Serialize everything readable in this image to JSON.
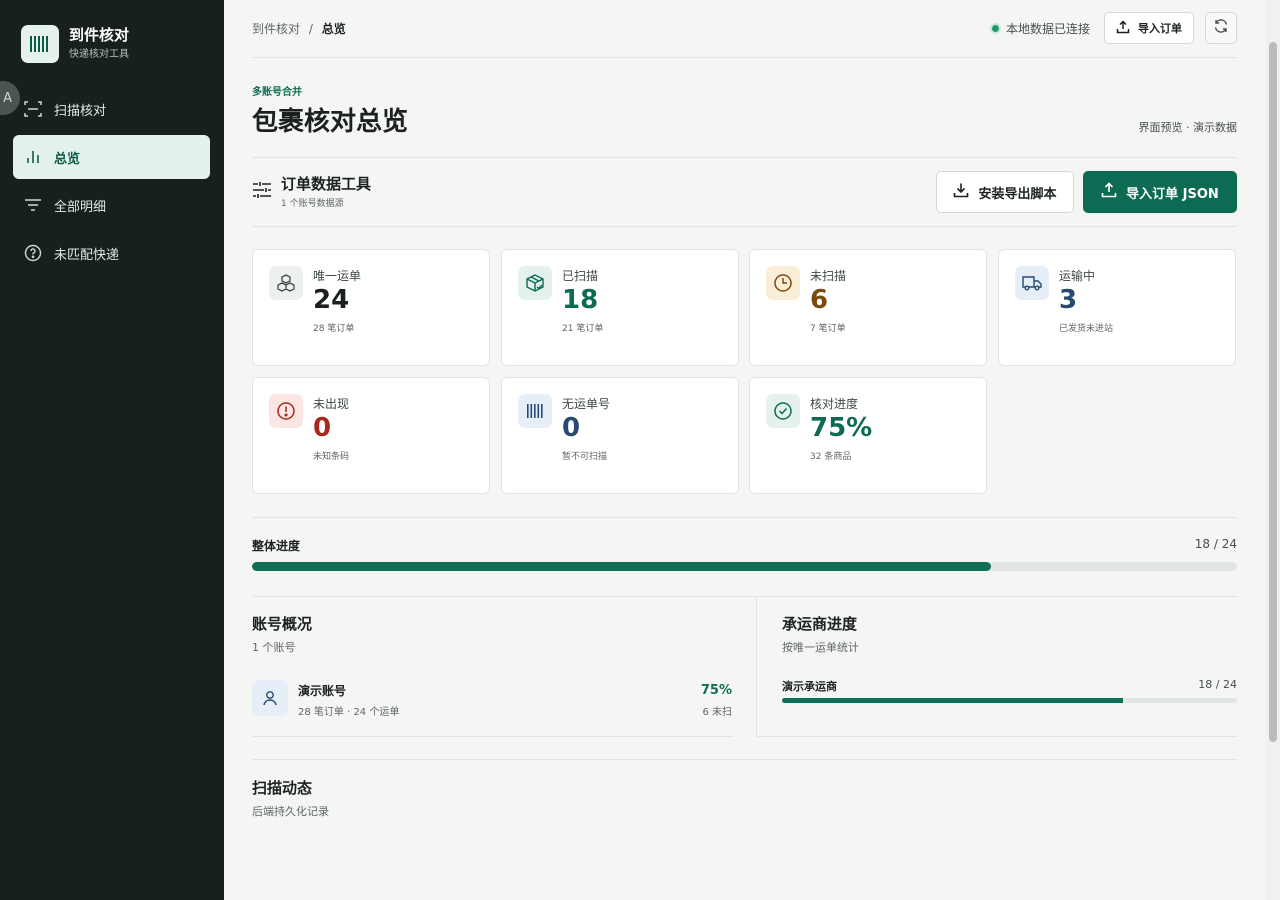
{
  "sidebar": {
    "brand_title": "到件核对",
    "brand_sub": "快递核对工具",
    "lang_badge": "A",
    "items": [
      {
        "label": "扫描核对",
        "icon": "scan-icon"
      },
      {
        "label": "总览",
        "icon": "bar-chart-icon",
        "active": true
      },
      {
        "label": "全部明细",
        "icon": "filter-list-icon"
      },
      {
        "label": "未匹配快递",
        "icon": "question-circle-icon"
      }
    ]
  },
  "topbar": {
    "crumb_parent": "到件核对",
    "crumb_sep": "/",
    "crumb_current": "总览",
    "status": "本地数据已连接",
    "import_label": "导入订单"
  },
  "header": {
    "eyebrow": "多账号合并",
    "title": "包裹核对总览",
    "preview_note": "界面预览 · 演示数据"
  },
  "tools": {
    "title": "订单数据工具",
    "sub": "1 个账号数据源",
    "install_label": "安装导出脚本",
    "json_label": "导入订单 JSON"
  },
  "cards": [
    {
      "label": "唯一运单",
      "value": "24",
      "sub": "28 笔订单",
      "icon": "packages-icon",
      "color": "#1a211e",
      "bg": "#eef0ef"
    },
    {
      "label": "已扫描",
      "value": "18",
      "sub": "21 笔订单",
      "icon": "box-check-icon",
      "color": "#0d6b54",
      "bg": "#e4f1ec"
    },
    {
      "label": "未扫描",
      "value": "6",
      "sub": "7 笔订单",
      "icon": "clock-icon",
      "color": "#7a4a0e",
      "bg": "#fbeed8"
    },
    {
      "label": "运输中",
      "value": "3",
      "sub": "已发货未进站",
      "icon": "truck-icon",
      "color": "#264a72",
      "bg": "#e6eef7"
    },
    {
      "label": "未出现",
      "value": "0",
      "sub": "未知条码",
      "icon": "alert-circle-icon",
      "color": "#a8281e",
      "bg": "#fbe6e3"
    },
    {
      "label": "无运单号",
      "value": "0",
      "sub": "暂不可扫描",
      "icon": "barcode-icon",
      "color": "#264a72",
      "bg": "#e6eef7"
    },
    {
      "label": "核对进度",
      "value": "75%",
      "sub": "32 条商品",
      "icon": "check-circle-icon",
      "color": "#0d6b54",
      "bg": "#e4f1ec"
    }
  ],
  "progress": {
    "label": "整体进度",
    "count": "18 / 24",
    "fraction": 0.75
  },
  "accounts": {
    "title": "账号概况",
    "sub": "1 个账号",
    "items": [
      {
        "name": "演示账号",
        "meta": "28 笔订单 · 24 个运单",
        "pct": "75%",
        "unscanned": "6 未扫"
      }
    ]
  },
  "carriers": {
    "title": "承运商进度",
    "sub": "按唯一运单统计",
    "items": [
      {
        "name": "演示承运商",
        "count": "18 / 24",
        "fraction": 0.75
      }
    ]
  },
  "activity": {
    "title": "扫描动态",
    "sub": "后端持久化记录"
  }
}
